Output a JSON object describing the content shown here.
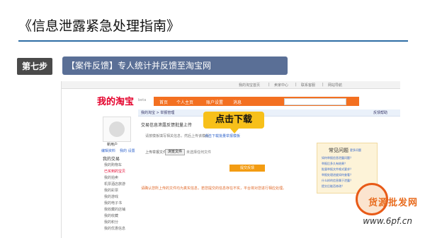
{
  "slide": {
    "title": "《信息泄露紧急处理指南》",
    "step_label": "第七步",
    "banner_text": "【案件反馈】专人统计并反馈至淘宝网"
  },
  "taobao": {
    "topbar_items": [
      "我的淘宝首页",
      "|",
      "卖家中心",
      "|",
      "联系客服",
      "|",
      "网站导航"
    ],
    "logo": "我的淘宝",
    "logo_sub": "beta",
    "nav_items": [
      "首页",
      "个人主页",
      "账户设置",
      "消息"
    ],
    "breadcrumb": "我的淘宝 > 举报管理",
    "sub_right": "反馈帮助",
    "sidebar": {
      "name": "新用户",
      "links": [
        "编辑资料",
        "我的 设置"
      ],
      "section": "我的交易",
      "items": [
        "我的购物车",
        "已买到的宝贝",
        "我的拍卖",
        "机票酒店旅游",
        "我的彩票",
        "我的游戏",
        "我的电子书",
        "我收藏的店铺",
        "我的收藏",
        "我的积分",
        "我的优惠信息"
      ]
    },
    "main": {
      "heading": "交易信息泄露反馈批量上传",
      "step1_text": "请按模板填写相关信息，然后上传该模版",
      "template_link": "点击下载批量举报模板",
      "file_label": "上传举报文件：",
      "file_button": "浏览文件",
      "file_status": "未选择任何文件",
      "submit_label": "提交反馈",
      "warning": "请确认您所上传的文件均为真实信息，若您提交的信息存在不实，平台将对您进行相应处理。"
    },
    "callout": "点击下载",
    "faq": {
      "title": "常见问题",
      "more": "更多问题",
      "items": [
        "如何举报信息泄露问题？",
        "举报后多久有结果？",
        "批量举报文件格式要求？",
        "举报处理进度如何查看？",
        "什么样的信息属于泄露？",
        "提交后能否修改？"
      ]
    }
  },
  "watermark": {
    "cn": "货源批发网",
    "url": "www.6pf.cn"
  }
}
